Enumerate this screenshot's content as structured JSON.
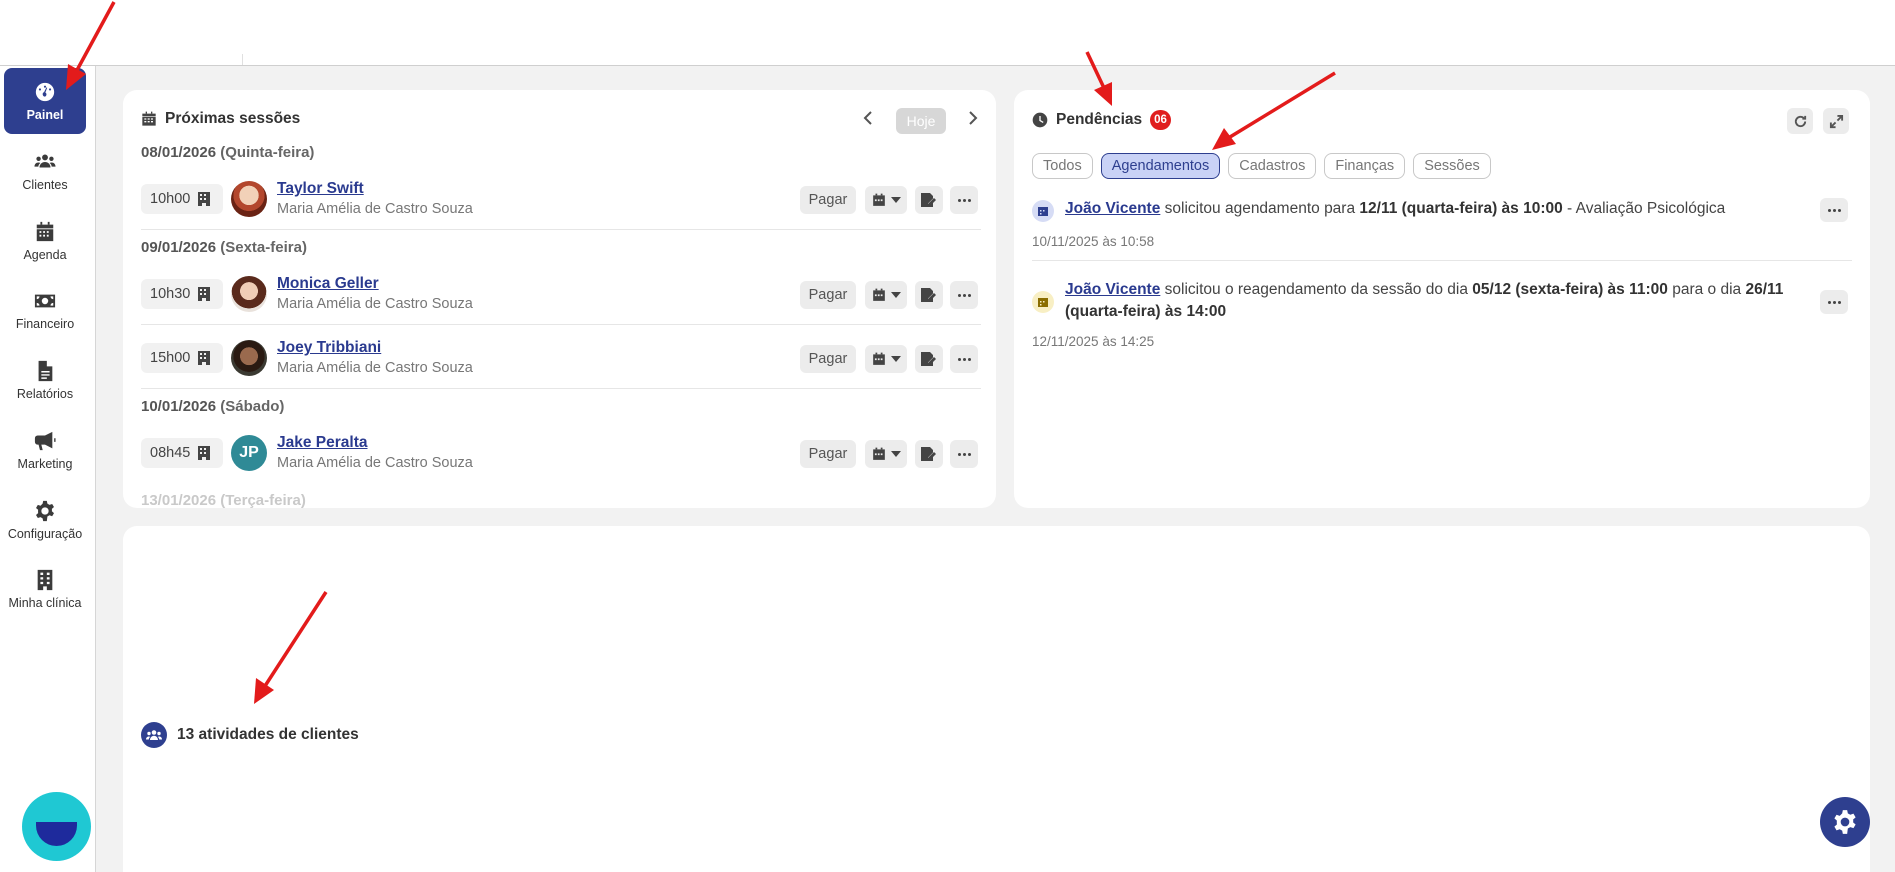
{
  "sidebar": {
    "items": [
      {
        "label": "Painel",
        "icon": "gauge-icon",
        "active": true
      },
      {
        "label": "Clientes",
        "icon": "users-icon"
      },
      {
        "label": "Agenda",
        "icon": "calendar-icon"
      },
      {
        "label": "Financeiro",
        "icon": "money-icon"
      },
      {
        "label": "Relatórios",
        "icon": "file-icon"
      },
      {
        "label": "Marketing",
        "icon": "megaphone-icon"
      },
      {
        "label": "Configuração",
        "icon": "gear-icon"
      },
      {
        "label": "Minha clínica",
        "icon": "building-icon"
      }
    ]
  },
  "sessions": {
    "title": "Próximas sessões",
    "today_label": "Hoje",
    "pay_label": "Pagar",
    "days": [
      {
        "date": "08/01/2026",
        "weekday": "(Quinta-feira)"
      },
      {
        "date": "09/01/2026",
        "weekday": "(Sexta-feira)"
      },
      {
        "date": "10/01/2026",
        "weekday": "(Sábado)"
      }
    ],
    "rows": [
      {
        "time": "10h00",
        "name": "Taylor Swift",
        "therapist": "Maria Amélia de Castro Souza"
      },
      {
        "time": "10h30",
        "name": "Monica Geller",
        "therapist": "Maria Amélia de Castro Souza"
      },
      {
        "time": "15h00",
        "name": "Joey Tribbiani",
        "therapist": "Maria Amélia de Castro Souza"
      },
      {
        "time": "08h45",
        "name": "Jake Peralta",
        "therapist": "Maria Amélia de Castro Souza",
        "initials": "JP"
      }
    ],
    "faded_next": "13/01/2026 (Terça-feira)"
  },
  "pendencias": {
    "title": "Pendências",
    "count": "06",
    "filters": [
      "Todos",
      "Agendamentos",
      "Cadastros",
      "Finanças",
      "Sessões"
    ],
    "active_filter": "Agendamentos",
    "items": [
      {
        "who": "João Vicente",
        "t1": " solicitou agendamento para ",
        "b1": "12/11 (quarta-feira) às 10:00",
        "t2": " - Avaliação Psicológica",
        "date": "10/11/2025 às 10:58"
      },
      {
        "who": "João Vicente",
        "t1": " solicitou o reagendamento da sessão do dia ",
        "b1": "05/12 (sexta-feira) às 11:00",
        "t2": " para o dia ",
        "b2": "26/11 (quarta-feira) às 14:00",
        "date": "12/11/2025 às 14:25"
      }
    ]
  },
  "activity": {
    "title": "13 atividades de clientes"
  },
  "colors": {
    "brand": "#2e3f8f",
    "badge": "#e01e1e",
    "annotation_arrow": "#e31b1b",
    "chat_bubble": "#1fc8d3"
  }
}
